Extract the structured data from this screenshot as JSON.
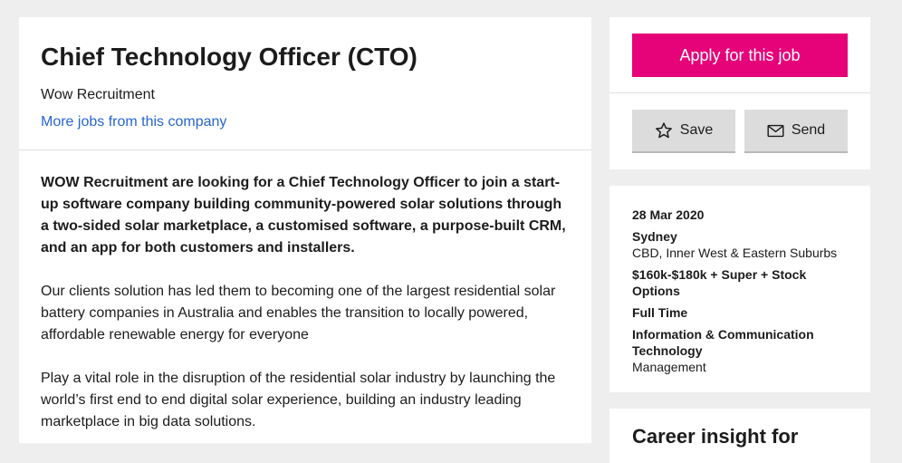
{
  "job": {
    "title": "Chief Technology Officer (CTO)",
    "company": "Wow Recruitment",
    "more_jobs_link": "More jobs from this company"
  },
  "description": {
    "lead": "WOW Recruitment are looking for a Chief Technology Officer to join  a start-up software company building community-powered solar solutions through a two-sided solar marketplace, a customised software, a purpose-built CRM, and an app for both customers and installers.",
    "paragraphs": [
      "Our clients solution has led them to becoming one of the largest residential solar battery companies in Australia and enables the transition to locally powered, affordable renewable energy for everyone",
      "Play a vital role in the disruption of the residential solar industry by launching the world’s first end to end digital solar experience, building an industry leading marketplace in big data solutions."
    ]
  },
  "actions": {
    "apply_label": "Apply for this job",
    "save_label": "Save",
    "send_label": "Send",
    "save_icon": "star-outline-icon",
    "send_icon": "envelope-icon"
  },
  "details": {
    "date": "28 Mar 2020",
    "location": "Sydney",
    "area": "CBD, Inner West & Eastern Suburbs",
    "salary": "$160k-$180k + Super + Stock Options",
    "work_type": "Full Time",
    "classification": "Information & Communication Technology",
    "sub_classification": "Management"
  },
  "career_insight": {
    "title": "Career insight for"
  },
  "colors": {
    "apply_button": "#e60278",
    "link": "#2765cf",
    "background": "#eeeeee"
  }
}
